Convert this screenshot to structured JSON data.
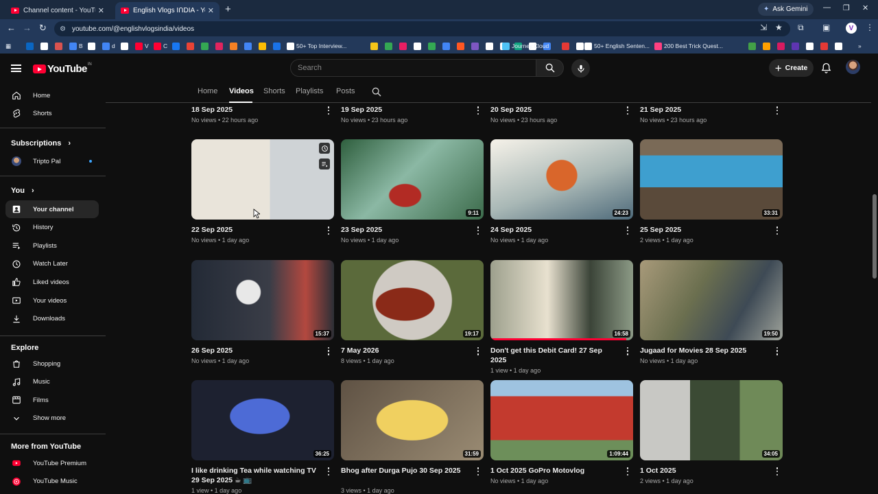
{
  "browser": {
    "tabs": [
      {
        "title": "Channel content - YouTube Stu",
        "active": false
      },
      {
        "title": "English Vlogs IՈDIA - YouTube",
        "active": true
      }
    ],
    "ask_gemini": "Ask Gemini",
    "url": "youtube.com/@englishvlogsindia/videos",
    "profile_letter": "V",
    "bookmarks": [
      {
        "label": "",
        "color": "#0a66c2"
      },
      {
        "label": "",
        "color": "#ffffff"
      },
      {
        "label": "",
        "color": "#d9534f"
      },
      {
        "label": "B",
        "color": "#4285f4"
      },
      {
        "label": "",
        "color": "#ffffff"
      },
      {
        "label": "d",
        "color": "#4285f4"
      },
      {
        "label": "",
        "color": "#ffffff"
      },
      {
        "label": "V",
        "color": "#ff0033"
      },
      {
        "label": "C",
        "color": "#ff0033"
      },
      {
        "label": "",
        "color": "#1877f2"
      },
      {
        "label": "",
        "color": "#ea4335"
      },
      {
        "label": "",
        "color": "#34a853"
      },
      {
        "label": "",
        "color": "#e0245e"
      },
      {
        "label": "",
        "color": "#f48024"
      },
      {
        "label": "",
        "color": "#4285f4"
      },
      {
        "label": "",
        "color": "#fbbc04"
      },
      {
        "label": "",
        "color": "#1a73e8"
      },
      {
        "label": "50+ Top Interview...",
        "color": "#ffffff"
      },
      {
        "label": "",
        "color": "#f5c518"
      },
      {
        "label": "",
        "color": "#34a853"
      },
      {
        "label": "",
        "color": "#e91e63"
      },
      {
        "label": "",
        "color": "#ffffff"
      },
      {
        "label": "",
        "color": "#34a853"
      },
      {
        "label": "",
        "color": "#4285f4"
      },
      {
        "label": "",
        "color": "#ff5722"
      },
      {
        "label": "",
        "color": "#7e57c2"
      },
      {
        "label": "",
        "color": "#ffffff"
      },
      {
        "label": "",
        "color": "#ffffff"
      },
      {
        "label": "",
        "color": "#10a37f"
      },
      {
        "label": "",
        "color": "#ffffff"
      },
      {
        "label": "",
        "color": "#4285f4"
      },
      {
        "label": "Journey.Cloud",
        "color": "#4fc3f7"
      },
      {
        "label": "",
        "color": "#e53935"
      },
      {
        "label": "",
        "color": "#ffffff"
      },
      {
        "label": "50+ English Senten...",
        "color": "#ffffff"
      },
      {
        "label": "200 Best Trick Quest...",
        "color": "#ff4081"
      },
      {
        "label": "",
        "color": "#43a047"
      },
      {
        "label": "",
        "color": "#ffa000"
      },
      {
        "label": "",
        "color": "#d81b60"
      },
      {
        "label": "",
        "color": "#5e35b1"
      },
      {
        "label": "",
        "color": "#ffffff"
      },
      {
        "label": "",
        "color": "#e53935"
      },
      {
        "label": "",
        "color": "#ffffff"
      },
      {
        "label": "",
        "color": "#43a047"
      },
      {
        "label": "",
        "color": "#ff0033"
      }
    ]
  },
  "header": {
    "logo_text": "YouTube",
    "country_code": "IN",
    "search_placeholder": "Search",
    "create_label": "Create"
  },
  "sidebar": {
    "top": [
      {
        "label": "Home",
        "icon": "home-icon"
      },
      {
        "label": "Shorts",
        "icon": "shorts-icon"
      }
    ],
    "subscriptions_title": "Subscriptions",
    "subscriptions": [
      {
        "label": "Tripto Pal"
      }
    ],
    "you_title": "You",
    "you_items": [
      {
        "label": "Your channel",
        "icon": "your-channel-icon",
        "selected": true
      },
      {
        "label": "History",
        "icon": "history-icon"
      },
      {
        "label": "Playlists",
        "icon": "playlists-icon"
      },
      {
        "label": "Watch Later",
        "icon": "watch-later-icon"
      },
      {
        "label": "Liked videos",
        "icon": "liked-icon"
      },
      {
        "label": "Your videos",
        "icon": "your-videos-icon"
      },
      {
        "label": "Downloads",
        "icon": "downloads-icon"
      }
    ],
    "explore_title": "Explore",
    "explore_items": [
      {
        "label": "Shopping",
        "icon": "shopping-icon"
      },
      {
        "label": "Music",
        "icon": "music-icon"
      },
      {
        "label": "Films",
        "icon": "films-icon"
      },
      {
        "label": "Show more",
        "icon": "chevron-down-icon"
      }
    ],
    "more_title": "More from YouTube",
    "more_items": [
      {
        "label": "YouTube Premium",
        "icon": "youtube-premium-icon"
      },
      {
        "label": "YouTube Music",
        "icon": "youtube-music-icon"
      }
    ]
  },
  "channel_tabs": [
    "Home",
    "Videos",
    "Shorts",
    "Playlists",
    "Posts"
  ],
  "active_tab": "Videos",
  "videos": [
    {
      "title": "18 Sep 2025",
      "meta": "No views • 22 hours ago"
    },
    {
      "title": "19 Sep 2025",
      "meta": "No views • 23 hours ago"
    },
    {
      "title": "20 Sep 2025",
      "meta": "No views • 23 hours ago"
    },
    {
      "title": "21 Sep 2025",
      "meta": "No views • 23 hours ago"
    },
    {
      "title": "22 Sep 2025",
      "meta": "No views • 1 day ago",
      "duration": "",
      "hovered": true
    },
    {
      "title": "23 Sep 2025",
      "meta": "No views • 1 day ago",
      "duration": "9:11"
    },
    {
      "title": "24 Sep 2025",
      "meta": "No views • 1 day ago",
      "duration": "24:23"
    },
    {
      "title": "25 Sep 2025",
      "meta": "2 views • 1 day ago",
      "duration": "33:31"
    },
    {
      "title": "26 Sep 2025",
      "meta": "No views • 1 day ago",
      "duration": "15:37"
    },
    {
      "title": "7 May 2026",
      "meta": "8 views • 1 day ago",
      "duration": "19:17"
    },
    {
      "title": "Don't get this Debit Card! 27 Sep 2025",
      "meta": "1 view • 1 day ago",
      "duration": "16:58",
      "progress": 0.95
    },
    {
      "title": "Jugaad for Movies  28 Sep 2025",
      "meta": "No views • 1 day ago",
      "duration": "19:50"
    },
    {
      "title": "I like drinking Tea while watching TV 29 Sep 2025 ☕ 📺",
      "meta": "1 view • 1 day ago",
      "duration": "36:25"
    },
    {
      "title": "Bhog after Durga Pujo   30 Sep 2025",
      "meta": "3 views • 1 day ago",
      "duration": "31:59"
    },
    {
      "title": "1 Oct 2025 GoPro Motovlog",
      "meta": "No views • 1 day ago",
      "duration": "1:09:44"
    },
    {
      "title": "1 Oct 2025",
      "meta": "2 views • 1 day ago",
      "duration": "34:05"
    }
  ]
}
